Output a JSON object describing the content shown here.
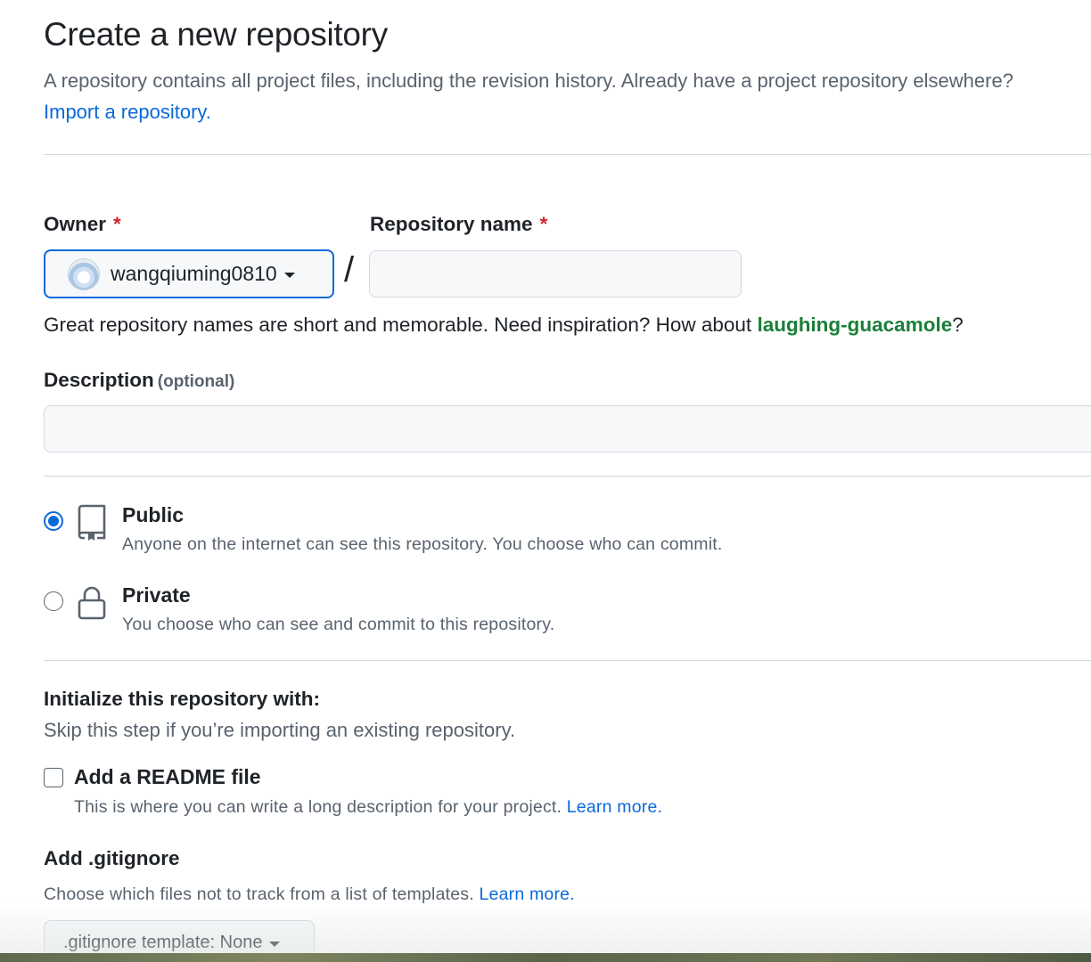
{
  "header": {
    "title": "Create a new repository",
    "intro_text": "A repository contains all project files, including the revision history. Already have a project repository elsewhere?",
    "import_link": "Import a repository."
  },
  "owner": {
    "label": "Owner",
    "required_mark": "*",
    "value": "wangqiuming0810"
  },
  "repo_name": {
    "label": "Repository name",
    "required_mark": "*",
    "value": "",
    "separator": "/"
  },
  "name_hint": {
    "text": "Great repository names are short and memorable. Need inspiration? How about",
    "suggestion": "laughing-guacamole",
    "suffix": "?"
  },
  "description": {
    "label": "Description",
    "optional": "(optional)",
    "value": ""
  },
  "visibility": {
    "selected": "public",
    "options": [
      {
        "id": "public",
        "title": "Public",
        "description": "Anyone on the internet can see this repository. You choose who can commit.",
        "icon": "repo-icon"
      },
      {
        "id": "private",
        "title": "Private",
        "description": "You choose who can see and commit to this repository.",
        "icon": "lock-icon"
      }
    ]
  },
  "initialize": {
    "title": "Initialize this repository with:",
    "subtitle": "Skip this step if you’re importing an existing repository.",
    "readme": {
      "label": "Add a README file",
      "checked": false,
      "description": "This is where you can write a long description for your project.",
      "learn_more": "Learn more."
    }
  },
  "gitignore": {
    "title": "Add .gitignore",
    "description": "Choose which files not to track from a list of templates.",
    "learn_more": "Learn more.",
    "select_label": ".gitignore template: None"
  },
  "colors": {
    "accent": "#0969da",
    "success": "#1a7f37",
    "danger": "#d1242f",
    "muted": "#59636e",
    "border": "#d1d9e0"
  }
}
